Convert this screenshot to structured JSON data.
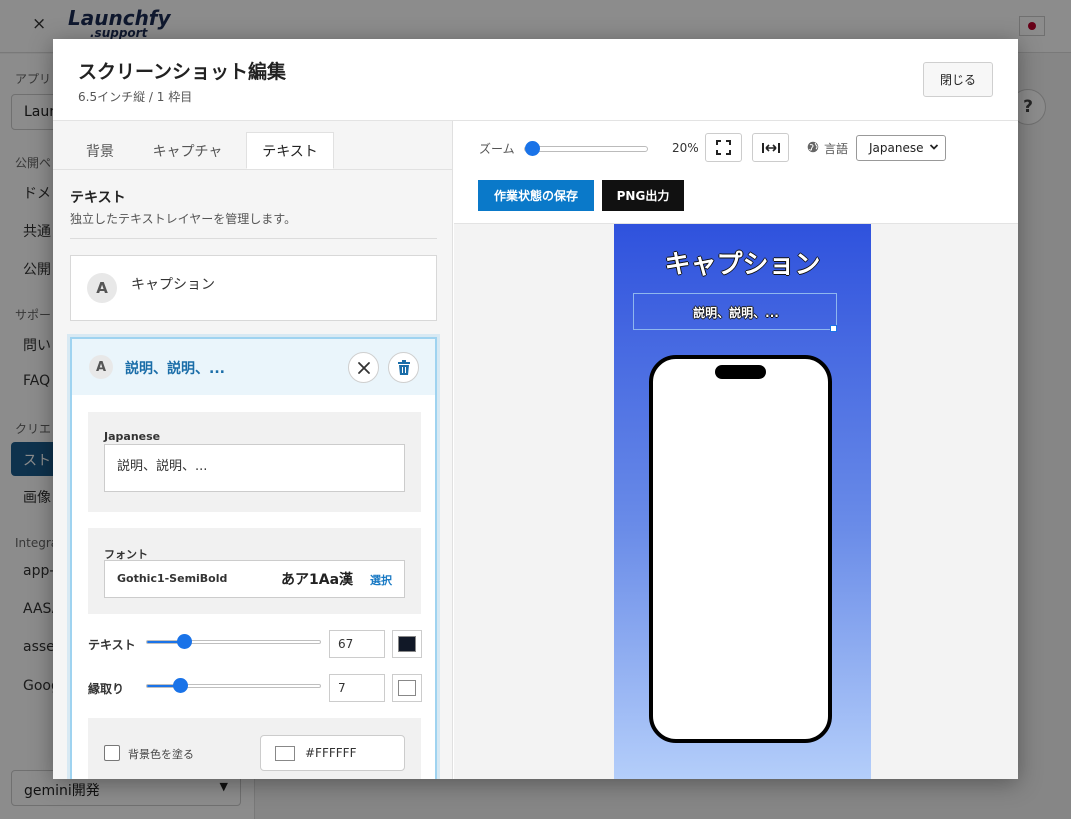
{
  "app": {
    "close_glyph": "×",
    "logo_main": "Launchfy",
    "logo_sub": ".support",
    "help_glyph": "?",
    "sidebar": {
      "items": [
        {
          "text": "アプリ",
          "kind": "section"
        },
        {
          "text": "Laun",
          "kind": "select"
        },
        {
          "text": "公開ペ",
          "kind": "section"
        },
        {
          "text": "ドメ",
          "kind": "item"
        },
        {
          "text": "共通",
          "kind": "item"
        },
        {
          "text": "公開",
          "kind": "item"
        },
        {
          "text": "サポー",
          "kind": "section"
        },
        {
          "text": "問い",
          "kind": "item"
        },
        {
          "text": "FAQ",
          "kind": "item"
        },
        {
          "text": "クリエ",
          "kind": "section"
        },
        {
          "text": "スト",
          "kind": "active"
        },
        {
          "text": "画像",
          "kind": "item"
        },
        {
          "text": "Integra",
          "kind": "section"
        },
        {
          "text": "app-a",
          "kind": "item"
        },
        {
          "text": "AASA",
          "kind": "item"
        },
        {
          "text": "asse",
          "kind": "item"
        },
        {
          "text": "Goog",
          "kind": "item"
        }
      ],
      "project_select": "gemini開発",
      "project_chevron": "▼"
    }
  },
  "modal": {
    "title": "スクリーンショット編集",
    "subtitle": "6.5インチ縦 / 1 枠目",
    "close_label": "閉じる"
  },
  "tabs": [
    {
      "label": "背景",
      "active": false
    },
    {
      "label": "キャプチャ",
      "active": false
    },
    {
      "label": "テキスト",
      "active": true
    }
  ],
  "text_section": {
    "title": "テキスト",
    "description": "独立したテキストレイヤーを管理します。"
  },
  "layers": [
    {
      "avatar": "A",
      "name": "キャプション"
    },
    {
      "avatar": "A",
      "name": "説明、説明、..."
    }
  ],
  "editor": {
    "lang_label": "Japanese",
    "text_value": "説明、説明、...",
    "font_label": "フォント",
    "font_name": "Gothic1-SemiBold",
    "font_sample": "あア1Aa漢",
    "font_select": "選択",
    "size_label": "テキスト",
    "size_value": "67",
    "size_fraction": 0.19,
    "size_color": "#111827",
    "stroke_label": "縁取り",
    "stroke_value": "7",
    "stroke_fraction": 0.16,
    "stroke_color": "#FFFFFF",
    "bg_fill_label": "背景色を塗る",
    "bg_fill_checked": false,
    "bg_color": "#FFFFFF"
  },
  "toolbar": {
    "zoom_label": "ズーム",
    "zoom_value": "20%",
    "fit_icon": "fullscreen-icon",
    "width_icon": "fit-width-icon",
    "lang_label": "言語",
    "lang_value": "Japanese",
    "save_label": "作業状態の保存",
    "png_label": "PNG出力"
  },
  "canvas": {
    "caption": "キャプション",
    "description": "説明、説明、...",
    "gradient_top": "#2f52dd",
    "gradient_bottom": "#b4cefa"
  },
  "colors": {
    "accent": "#1a73e8",
    "save_button": "#0a79c9",
    "png_button": "#111111",
    "active_layer_text": "#1a6da8"
  }
}
